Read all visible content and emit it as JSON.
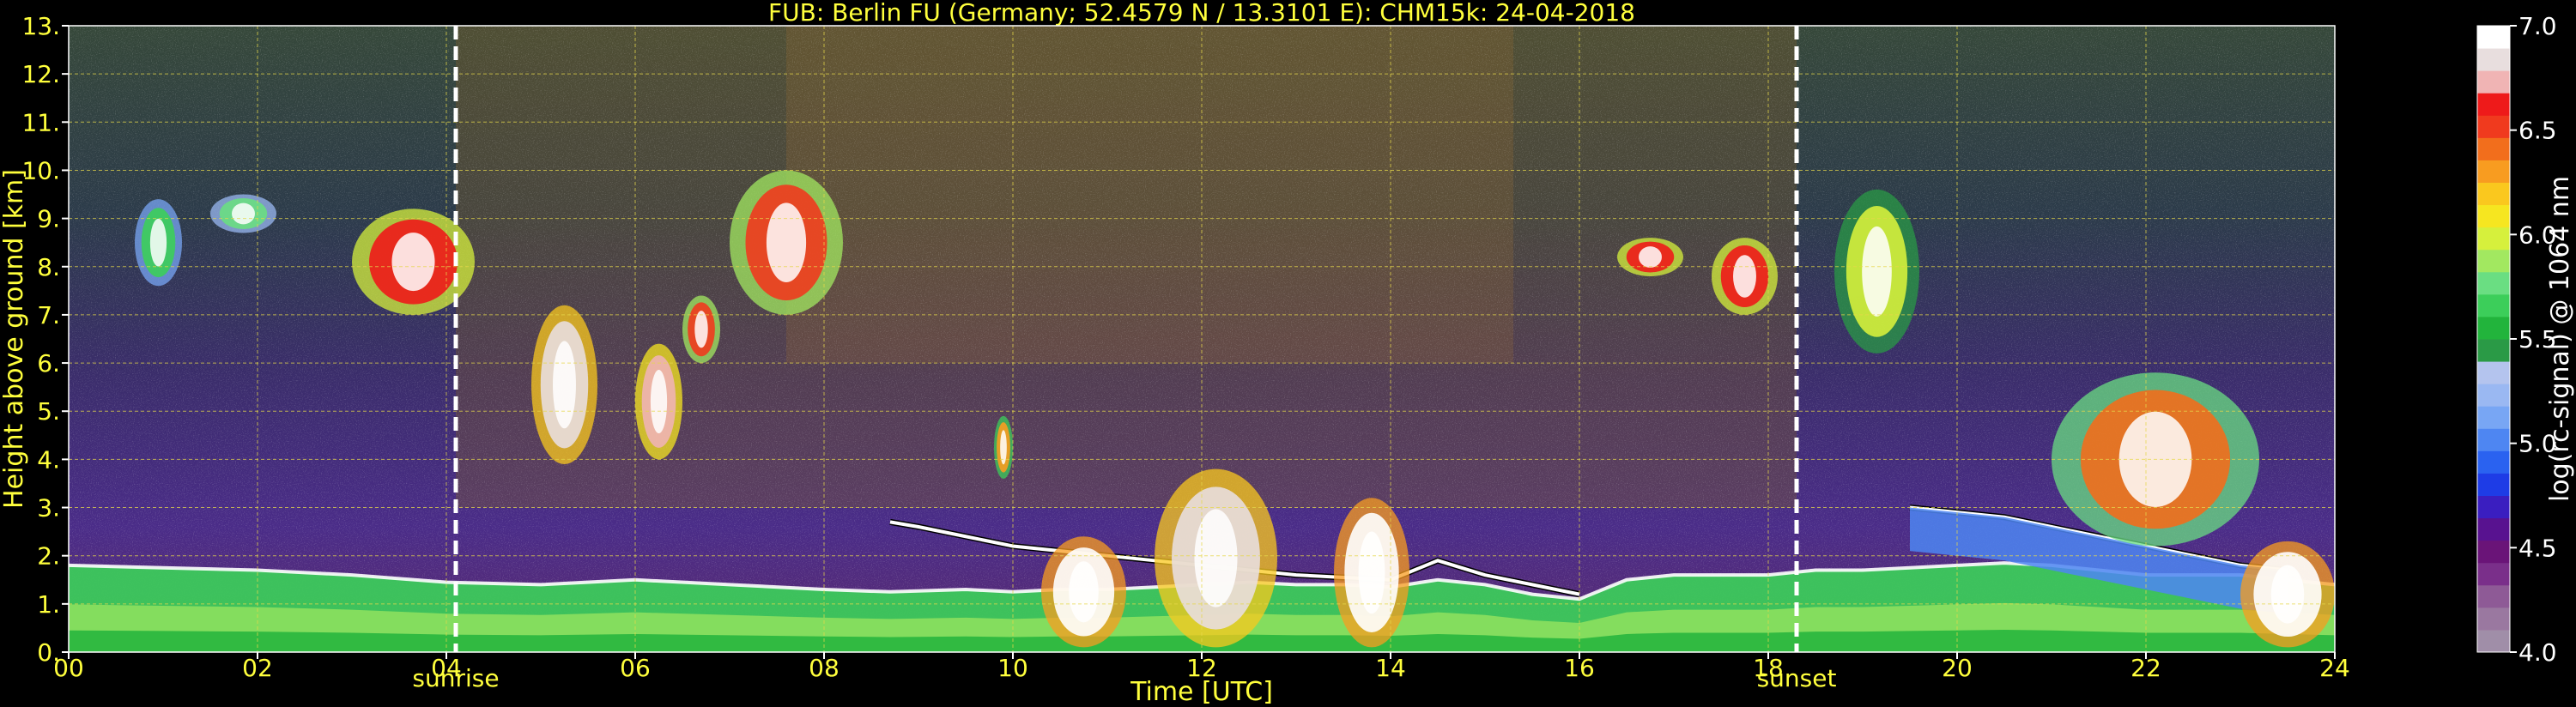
{
  "chart_data": {
    "type": "heatmap",
    "title": "FUB: Berlin FU (Germany; 52.4579 N / 13.3101 E):    CHM15k: 24-04-2018",
    "xlabel": "Time [UTC]",
    "ylabel": "Height above ground [km]",
    "xlim": [
      0,
      24
    ],
    "ylim": [
      0,
      13
    ],
    "x_ticks": [
      "00",
      "02",
      "04",
      "06",
      "08",
      "10",
      "12",
      "14",
      "16",
      "18",
      "20",
      "22",
      "24"
    ],
    "y_ticks": [
      "0.",
      "1.",
      "2.",
      "3.",
      "4.",
      "5.",
      "6.",
      "7.",
      "8.",
      "9.",
      "10.",
      "11.",
      "12.",
      "13."
    ],
    "grid": true,
    "events": [
      {
        "label": "sunrise",
        "x": 4.1
      },
      {
        "label": "sunset",
        "x": 18.3
      }
    ],
    "colorbar": {
      "label": "log(rc-signal) @ 1064 nm",
      "range": [
        4.0,
        7.0
      ],
      "ticks": [
        "4.0",
        "4.5",
        "5.0",
        "5.5",
        "6.0",
        "6.5",
        "7.0"
      ],
      "colors": [
        "#a08ea8",
        "#9a78a0",
        "#8e5a96",
        "#7a2f8a",
        "#6a1478",
        "#581290",
        "#3a1ec0",
        "#1e3ce6",
        "#2a62f0",
        "#4e86f2",
        "#78a6f4",
        "#9ab8f2",
        "#b4c4ee",
        "#2a9a46",
        "#22b43c",
        "#3cce5a",
        "#6ade82",
        "#a2e860",
        "#d6f03c",
        "#f6e620",
        "#fac81e",
        "#f89c20",
        "#f26e1c",
        "#f03a1e",
        "#ee1a1a",
        "#f0b4b4",
        "#e8dede",
        "#ffffff"
      ]
    },
    "layers": [
      {
        "name": "boundary-layer",
        "x": [
          0,
          1,
          2,
          3,
          4,
          5,
          6,
          7,
          8,
          8.7,
          9.5,
          10,
          10.5,
          11,
          11.5,
          12,
          12.5,
          13,
          13.5,
          14,
          14.5,
          15,
          15.5,
          16,
          16.5,
          17,
          17.5,
          18,
          18.5,
          19,
          19.5,
          20,
          20.5,
          21,
          21.5,
          22,
          22.5,
          23,
          23.5,
          24
        ],
        "top": [
          1.8,
          1.75,
          1.7,
          1.6,
          1.45,
          1.4,
          1.5,
          1.4,
          1.3,
          1.25,
          1.3,
          1.25,
          1.3,
          1.3,
          1.35,
          1.4,
          1.45,
          1.4,
          1.4,
          1.35,
          1.5,
          1.4,
          1.2,
          1.1,
          1.5,
          1.6,
          1.6,
          1.6,
          1.7,
          1.7,
          1.75,
          1.8,
          1.85,
          1.8,
          1.7,
          1.6,
          1.6,
          1.6,
          1.5,
          1.4
        ]
      },
      {
        "name": "aerosol-top",
        "x": [
          8.7,
          9,
          9.5,
          10,
          10.5,
          11,
          11.5,
          12,
          12.5,
          13,
          13.5,
          14,
          14.5,
          15,
          15.5,
          16
        ],
        "top": [
          2.7,
          2.6,
          2.4,
          2.2,
          2.1,
          2.0,
          1.9,
          1.8,
          1.7,
          1.6,
          1.55,
          1.5,
          1.9,
          1.6,
          1.4,
          1.2
        ]
      },
      {
        "name": "elevated-layer",
        "x": [
          19.5,
          20,
          20.5,
          21,
          21.5,
          22,
          22.5,
          23,
          23.5
        ],
        "top": [
          3.0,
          2.9,
          2.8,
          2.6,
          2.4,
          2.2,
          2.0,
          1.8,
          1.7
        ]
      }
    ],
    "clouds": [
      {
        "x": [
          0.7,
          1.2
        ],
        "y": [
          7.6,
          9.4
        ],
        "level": 5.7
      },
      {
        "x": [
          1.5,
          2.2
        ],
        "y": [
          8.7,
          9.5
        ],
        "level": 5.8
      },
      {
        "x": [
          3.0,
          4.3
        ],
        "y": [
          7.0,
          9.2
        ],
        "level": 6.6
      },
      {
        "x": [
          4.9,
          5.6
        ],
        "y": [
          3.9,
          7.2
        ],
        "level": 6.8
      },
      {
        "x": [
          6.0,
          6.5
        ],
        "y": [
          4.0,
          6.4
        ],
        "level": 6.7
      },
      {
        "x": [
          6.5,
          6.9
        ],
        "y": [
          6.0,
          7.4
        ],
        "level": 6.5
      },
      {
        "x": [
          7.0,
          8.2
        ],
        "y": [
          7.0,
          10.0
        ],
        "level": 6.5
      },
      {
        "x": [
          9.8,
          10.0
        ],
        "y": [
          3.6,
          4.9
        ],
        "level": 6.3
      },
      {
        "x": [
          16.4,
          17.1
        ],
        "y": [
          7.8,
          8.6
        ],
        "level": 6.6
      },
      {
        "x": [
          17.4,
          18.1
        ],
        "y": [
          7.0,
          8.6
        ],
        "level": 6.6
      },
      {
        "x": [
          18.7,
          19.6
        ],
        "y": [
          6.2,
          9.6
        ],
        "level": 6.0
      },
      {
        "x": [
          21.0,
          23.2
        ],
        "y": [
          2.2,
          5.8
        ],
        "level": 6.4
      },
      {
        "x": [
          11.5,
          12.8
        ],
        "y": [
          0.1,
          3.8
        ],
        "level": 6.8
      },
      {
        "x": [
          10.3,
          11.2
        ],
        "y": [
          0.1,
          2.4
        ],
        "level": 6.9
      },
      {
        "x": [
          13.4,
          14.2
        ],
        "y": [
          0.1,
          3.2
        ],
        "level": 6.9
      },
      {
        "x": [
          23.0,
          24.0
        ],
        "y": [
          0.1,
          2.3
        ],
        "level": 6.9
      }
    ]
  }
}
